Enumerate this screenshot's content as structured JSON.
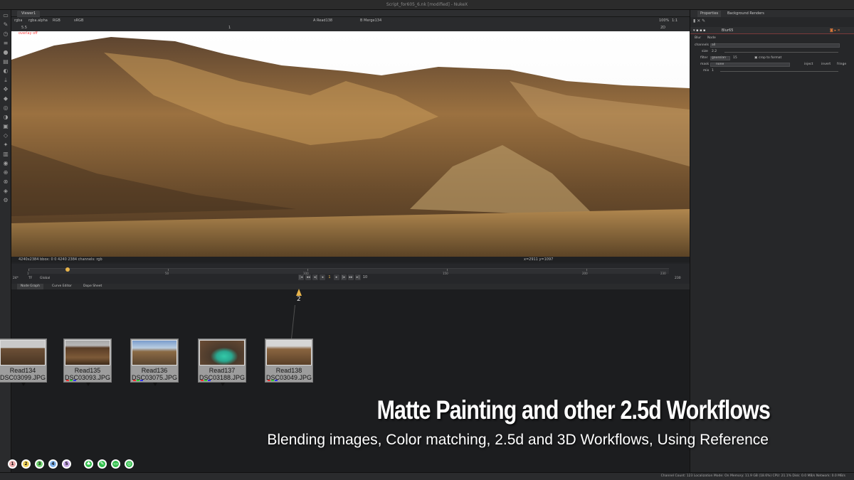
{
  "window": {
    "title": "Script_for605_6.nk [modified] - NukeX"
  },
  "viewer": {
    "tab": "Viewer1",
    "channels": "rgba",
    "alpha": "rgba.alpha",
    "colorspace": "RGB",
    "lut": "sRGB",
    "input_a": "A  Read138",
    "input_b": "B  Merge134",
    "gain": "5.5",
    "frame_field": "1",
    "zoom": "100%",
    "ratio": "1:1",
    "proxy": "2D",
    "overlay_label": "overlay off",
    "info_left": "4240x2384  bbox: 0 0 4240 2384 channels: rgb",
    "info_right": "x=2911 y=1097"
  },
  "timeline": {
    "ticks": [
      "1",
      "50",
      "100",
      "150",
      "200",
      "230"
    ],
    "fps": "24*",
    "mode": "TF",
    "range": "Global",
    "current_frame": "1",
    "end_frame": "230",
    "step": "10"
  },
  "node_graph": {
    "tabs": [
      "Node Graph",
      "Curve Editor",
      "Dope Sheet"
    ],
    "marker_label": "2",
    "nodes": [
      {
        "name": "Read134",
        "file": "DSC03099.JPG",
        "thumb": "mountain-thumb-1"
      },
      {
        "name": "Read135",
        "file": "DSC03093.JPG",
        "thumb": "mountain-thumb-2"
      },
      {
        "name": "Read136",
        "file": "DSC03075.JPG",
        "thumb": "mountain-thumb-3"
      },
      {
        "name": "Read137",
        "file": "DSC03188.JPG",
        "thumb": "lake-thumb"
      },
      {
        "name": "Read138",
        "file": "DSC03049.JPG",
        "thumb": "mountain-thumb-4"
      }
    ]
  },
  "properties": {
    "tabs": [
      "Properties",
      "Background Renders"
    ],
    "subtabs": [
      "Blur",
      "Node"
    ],
    "node_name": "Blur65",
    "channels_label": "channels",
    "channels_value": "all",
    "size_label": "size",
    "size_value": "2.2",
    "filter_label": "filter",
    "filter_value": "gaussian",
    "quality_value": "15",
    "crop_label": "crop to format",
    "mask_label": "mask",
    "mask_value": "none",
    "inject_label": "inject",
    "invert_label": "invert",
    "fringe_label": "fringe",
    "mix_label": "mix",
    "mix_value": "1"
  },
  "overlay_text": {
    "title": "Matte Painting and other 2.5d Workflows",
    "subtitle": "Blending images, Color matching, 2.5d and 3D Workflows, Using Reference"
  },
  "badges": [
    "1",
    "2",
    "3",
    "4",
    "5"
  ],
  "footer": {
    "stats": "Channel Count: 123  Localization Mode: On  Memory: 11.9 GB (18.6%)  CPU: 21.1%  Disk: 0.0 MB/s  Network: 0.0 MB/s"
  },
  "colors": {
    "accent": "#e8b44b",
    "node_bg": "#9d9d9d",
    "badge_green": "#2fbf4a"
  }
}
